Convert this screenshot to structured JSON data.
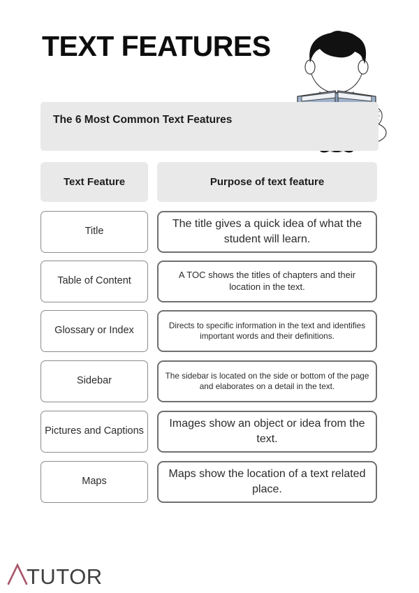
{
  "header": {
    "title": "TEXT FEATURES",
    "subtitle": "The 6 Most Common Text Features",
    "illustration_name": "boy-reading-book-illustration",
    "colors": {
      "subtitle_bar": "#e9e9e9",
      "hair": "#111111",
      "book": "#9fb2cc",
      "page_background": "#ffffff"
    }
  },
  "table": {
    "columns": [
      "Text Feature",
      "Purpose of text feature"
    ],
    "rows": [
      {
        "feature": "Title",
        "purpose": "The title gives a quick idea of what the student will learn."
      },
      {
        "feature": "Table of Content",
        "purpose": "A TOC shows the titles of chapters and their location in the text."
      },
      {
        "feature": "Glossary or Index",
        "purpose": "Directs to specific information in the text and identifies important words and their definitions."
      },
      {
        "feature": "Sidebar",
        "purpose": "The sidebar is located on the side or bottom of the page and elaborates on a detail in the text."
      },
      {
        "feature": "Pictures and Captions",
        "purpose": "Images show an object or idea from the text."
      },
      {
        "feature": "Maps",
        "purpose": "Maps show the location of a text related place."
      }
    ]
  },
  "logo": {
    "mark": "A",
    "word": "TUTOR",
    "mark_color": "#a8566b",
    "word_color": "#3f3f3f"
  }
}
